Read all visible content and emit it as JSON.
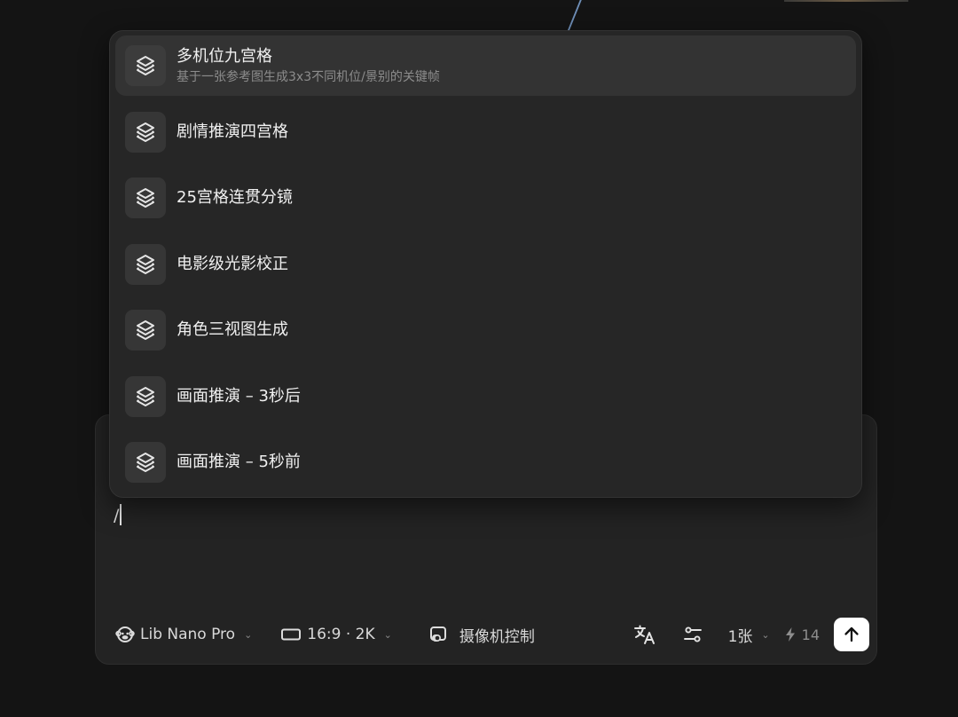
{
  "menu": {
    "items": [
      {
        "title": "多机位九宫格",
        "subtitle": "基于一张参考图生成3x3不同机位/景别的关键帧",
        "icon": "layers-icon",
        "active": true
      },
      {
        "title": "剧情推演四宫格",
        "subtitle": "",
        "icon": "layers-icon",
        "active": false
      },
      {
        "title": "25宫格连贯分镜",
        "subtitle": "",
        "icon": "layers-icon",
        "active": false
      },
      {
        "title": "电影级光影校正",
        "subtitle": "",
        "icon": "layers-icon",
        "active": false
      },
      {
        "title": "角色三视图生成",
        "subtitle": "",
        "icon": "layers-icon",
        "active": false
      },
      {
        "title": "画面推演 – 3秒后",
        "subtitle": "",
        "icon": "layers-icon",
        "active": false
      },
      {
        "title": "画面推演 – 5秒前",
        "subtitle": "",
        "icon": "layers-icon",
        "active": false
      }
    ]
  },
  "composer": {
    "input_value": "/",
    "toolbar": {
      "model_label": "Lib Nano Pro",
      "model_icon": "monkey-icon",
      "ratio_label": "16:9 · 2K",
      "ratio_icon": "rectangle-icon",
      "camera_label": "摄像机控制",
      "camera_icon": "camera-toggle-icon",
      "translate_icon": "translate-icon",
      "settings_icon": "sliders-icon",
      "count_label": "1张",
      "credits_value": "14",
      "credits_icon": "lightning-icon",
      "send_icon": "arrow-up-icon"
    }
  },
  "colors": {
    "background": "#141414",
    "panel": "#232323",
    "menu": "#262626",
    "active_item": "#333333",
    "send_button": "#ffffff"
  }
}
